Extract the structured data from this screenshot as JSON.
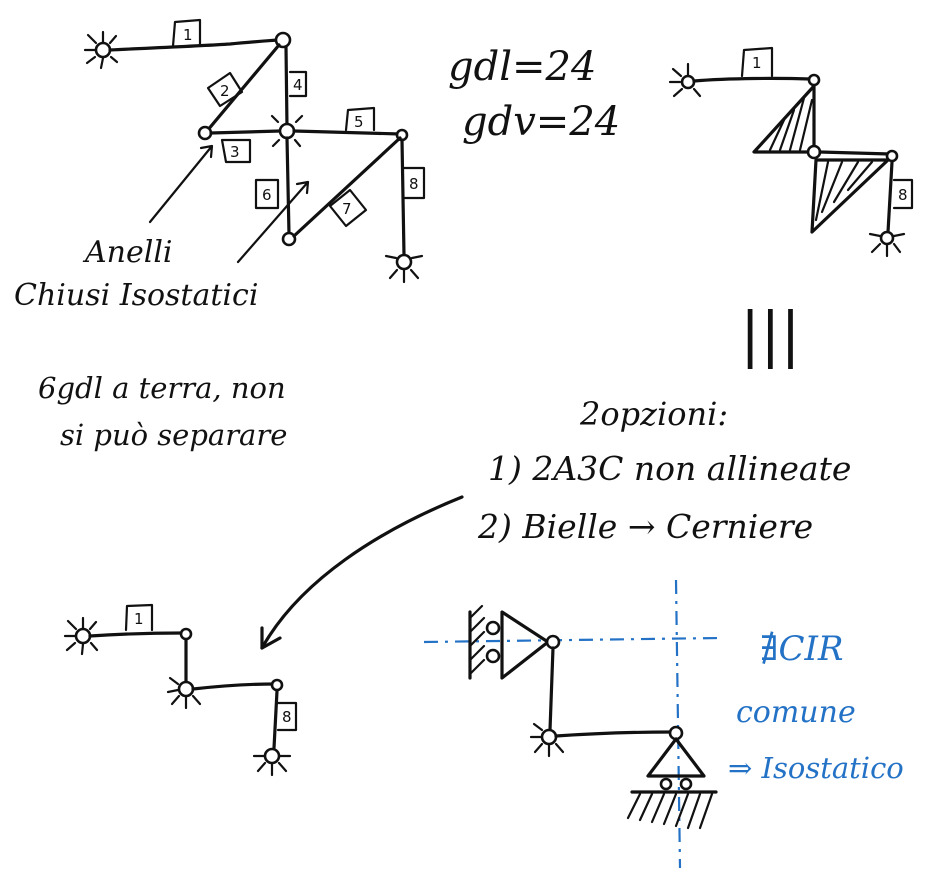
{
  "notes": {
    "gdl": "gdl=24",
    "gdv": "gdv=24",
    "anelli_1": "Anelli",
    "anelli_2": "Chiusi Isostatici",
    "gdl_line1": "6gdl a terra, non",
    "gdl_line2": "si può separare",
    "equiv": "|||",
    "options_title": "2opzioni:",
    "option1": "1) 2A3C non allineate",
    "option2": "2) Bielle → Cerniere",
    "blue1": "∄CIR",
    "blue2": "comune",
    "blue3": "⇒ Isostatico"
  },
  "beam_labels": {
    "b1": "1",
    "b2": "2",
    "b3": "3",
    "b4": "4",
    "b5": "5",
    "b6": "6",
    "b7": "7",
    "b8": "8",
    "r1": "1",
    "r8": "8",
    "s1": "1",
    "s8": "8"
  },
  "colors": {
    "ink": "#111111",
    "annotation_blue": "#2372c6"
  }
}
